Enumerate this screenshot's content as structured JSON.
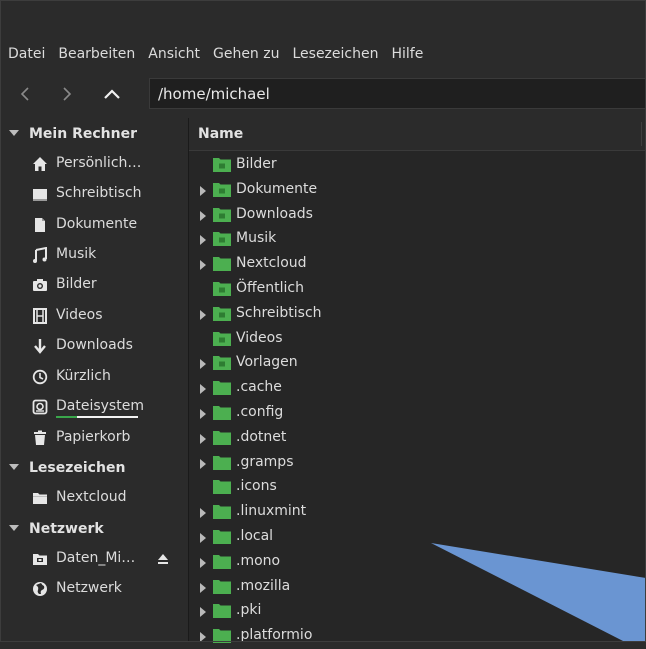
{
  "menu": [
    "Datei",
    "Bearbeiten",
    "Ansicht",
    "Gehen zu",
    "Lesezeichen",
    "Hilfe"
  ],
  "toolbar": {
    "path": "/home/michael"
  },
  "sidebar": {
    "computer": {
      "heading": "Mein Rechner",
      "items": [
        {
          "label": "Persönlich…",
          "icon": "home-icon"
        },
        {
          "label": "Schreibtisch",
          "icon": "desktop-icon"
        },
        {
          "label": "Dokumente",
          "icon": "document-icon"
        },
        {
          "label": "Musik",
          "icon": "music-icon"
        },
        {
          "label": "Bilder",
          "icon": "camera-icon"
        },
        {
          "label": "Videos",
          "icon": "film-icon"
        },
        {
          "label": "Downloads",
          "icon": "download-icon"
        },
        {
          "label": "Kürzlich",
          "icon": "clock-icon"
        },
        {
          "label": "Dateisystem",
          "icon": "drive-icon",
          "usage_fraction": 0.25
        },
        {
          "label": "Papierkorb",
          "icon": "trash-icon"
        }
      ]
    },
    "bookmarks": {
      "heading": "Lesezeichen",
      "items": [
        {
          "label": "Nextcloud",
          "icon": "folder-icon"
        }
      ]
    },
    "network": {
      "heading": "Netzwerk",
      "items": [
        {
          "label": "Daten_Mi…",
          "icon": "network-drive-icon"
        },
        {
          "label": "Netzwerk",
          "icon": "globe-icon"
        }
      ]
    }
  },
  "filelist": {
    "column_name": "Name",
    "rows": [
      {
        "name": "Bilder",
        "expandable": false,
        "emblem": "camera"
      },
      {
        "name": "Dokumente",
        "expandable": true,
        "emblem": "document"
      },
      {
        "name": "Downloads",
        "expandable": true,
        "emblem": "download"
      },
      {
        "name": "Musik",
        "expandable": true,
        "emblem": "music"
      },
      {
        "name": "Nextcloud",
        "expandable": true,
        "emblem": ""
      },
      {
        "name": "Öffentlich",
        "expandable": false,
        "emblem": "share"
      },
      {
        "name": "Schreibtisch",
        "expandable": true,
        "emblem": "desktop"
      },
      {
        "name": "Videos",
        "expandable": false,
        "emblem": "film"
      },
      {
        "name": "Vorlagen",
        "expandable": true,
        "emblem": "template"
      },
      {
        "name": ".cache",
        "expandable": true,
        "emblem": ""
      },
      {
        "name": ".config",
        "expandable": true,
        "emblem": ""
      },
      {
        "name": ".dotnet",
        "expandable": true,
        "emblem": ""
      },
      {
        "name": ".gramps",
        "expandable": true,
        "emblem": ""
      },
      {
        "name": ".icons",
        "expandable": false,
        "emblem": ""
      },
      {
        "name": ".linuxmint",
        "expandable": true,
        "emblem": ""
      },
      {
        "name": ".local",
        "expandable": true,
        "emblem": ""
      },
      {
        "name": ".mono",
        "expandable": true,
        "emblem": ""
      },
      {
        "name": ".mozilla",
        "expandable": true,
        "emblem": ""
      },
      {
        "name": ".pki",
        "expandable": true,
        "emblem": ""
      },
      {
        "name": ".platformio",
        "expandable": true,
        "emblem": ""
      }
    ]
  },
  "colors": {
    "folder_green": "#4caf50",
    "folder_dark": "#2e7d32",
    "usage_fill": "#3aa64b",
    "overlay_blue": "#6a95d2"
  }
}
